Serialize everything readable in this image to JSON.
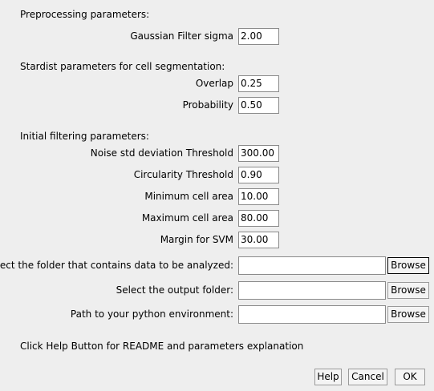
{
  "sections": {
    "preprocessing": "Preprocessing parameters:",
    "stardist": "Stardist parameters for cell segmentation:",
    "filtering": "Initial filtering parameters:"
  },
  "fields": {
    "gaussian_sigma": {
      "label": "Gaussian Filter sigma",
      "value": "2.00"
    },
    "overlap": {
      "label": "Overlap",
      "value": "0.25"
    },
    "probability": {
      "label": "Probability",
      "value": "0.50"
    },
    "noise_std": {
      "label": "Noise std deviation Threshold",
      "value": "300.00"
    },
    "circularity": {
      "label": "Circularity Threshold",
      "value": "0.90"
    },
    "min_area": {
      "label": "Minimum cell area",
      "value": "10.00"
    },
    "max_area": {
      "label": "Maximum cell area",
      "value": "80.00"
    },
    "margin_svm": {
      "label": "Margin for SVM",
      "value": "30.00"
    }
  },
  "paths": {
    "data_folder": {
      "label": "Select the folder that contains data to be analyzed:",
      "value": "",
      "button": "Browse"
    },
    "output_folder": {
      "label": "Select the output folder:",
      "value": "",
      "button": "Browse"
    },
    "python_env": {
      "label": "Path to your python environment:",
      "value": "",
      "button": "Browse"
    }
  },
  "help_text": "Click Help Button for README and parameters explanation",
  "buttons": {
    "help": "Help",
    "cancel": "Cancel",
    "ok": "OK"
  }
}
